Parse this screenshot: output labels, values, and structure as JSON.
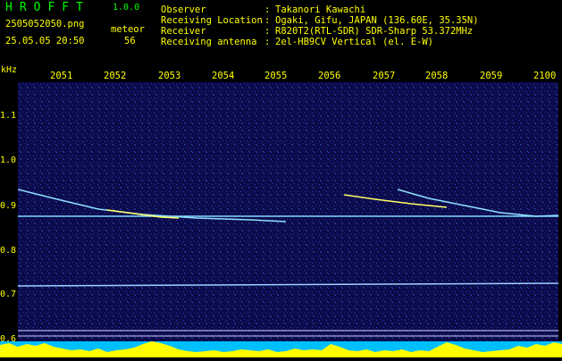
{
  "header": {
    "app_name": "HROFFT",
    "version": "1.0.0",
    "filename": "2505052050.png",
    "timestamp": "25.05.05 20:50",
    "meteor_label": "meteor",
    "meteor_count": "56",
    "observer_key": "Observer",
    "observer_value": "Takanori Kawachi",
    "location_key": "Receiving Location",
    "location_value": "Ogaki, Gifu, JAPAN (136.60E, 35.35N)",
    "receiver_key": "Receiver",
    "receiver_value": "R820T2(RTL-SDR) SDR-Sharp 53.372MHz",
    "antenna_key": "Receiving antenna",
    "antenna_value": "2el-HB9CV Vertical (el. E-W)",
    "separator": ":"
  },
  "axes": {
    "unit": "kHz",
    "time_ticks": [
      "2051",
      "2052",
      "2053",
      "2054",
      "2055",
      "2056",
      "2057",
      "2058",
      "2059",
      "2100"
    ],
    "freq_ticks": [
      "1.1",
      "1.0",
      "0.9",
      "0.8",
      "0.7",
      "0.6"
    ]
  },
  "colors": {
    "background": "#000000",
    "spectrogram": "#0b0b4a",
    "label": "#ffff00",
    "title": "#00ff00",
    "strip": "#00bfff",
    "signal": "#ffff00"
  }
}
